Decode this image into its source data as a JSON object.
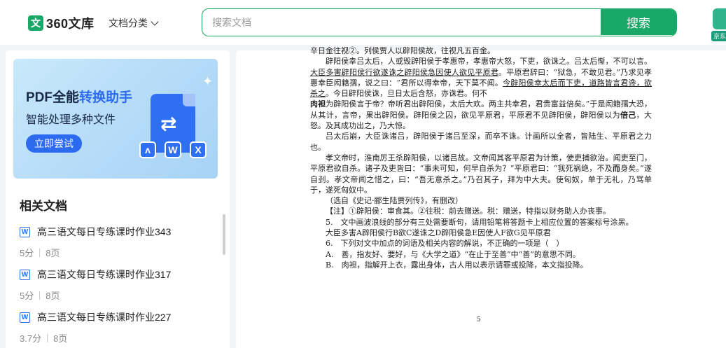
{
  "header": {
    "logo_mark": "文",
    "logo_text": "360文库",
    "category_label": "文档分类",
    "search_placeholder": "搜索文档",
    "search_button": "搜索",
    "promo_label": "京东"
  },
  "sidebar": {
    "banner": {
      "title_prefix": "PDF全能",
      "title_highlight": "转换助手",
      "subtitle": "智能处理多种文件",
      "cta": "立即尝试",
      "mini_icons": [
        "ᴧ",
        "W",
        "X"
      ]
    },
    "related_title": "相关文档",
    "related": [
      {
        "type_icon": "W",
        "name": "高三语文每日专练课时作业343",
        "score": "5分",
        "pages": "8页"
      },
      {
        "type_icon": "W",
        "name": "高三语文每日专练课时作业317",
        "score": "5分",
        "pages": "8页"
      },
      {
        "type_icon": "W",
        "name": "高三语文每日专练课时作业227",
        "score": "3.7分",
        "pages": "8页"
      }
    ]
  },
  "document": {
    "lines": {
      "l0": "辛日金往视②。列侯贾人以辟阳侯故，往视凡五百金。",
      "p1a": "辟阳侯幸吕太后，人或毁辟阳侯于孝惠帝，孝惠帝大怒，下吏，欲诛之。吕太后惭，不可以言。",
      "p1u": "大臣多害辟阳侯行欲遂诛之辟阳侯急因使人欲见平原君",
      "p1b": "。平原君辞曰：“狱急，不敢见君。”乃求见孝惠幸臣闳籍孺，说之曰：“君所以得幸帝，天下莫不闻。",
      "p1u2": "今辟阳侯幸太后而下吏，道路皆言君谗，欲杀之",
      "p1c": "。今日辟阳侯诛，旦日太后含怒，亦诛君。何不",
      "p1bold": "肉袒",
      "p1d": "为辟阳侯言于帝？帝听君出辟阳侯，太后大欢。两主共幸君，君贵富益倍矣。”于是闳籍孺大恐，从其计，言帝，果出辟阳侯。辟阳侯之囚，欲见平原君，平原君不见辟阳侯，辟阳侯以为",
      "p1bold2": "倍己",
      "p1e": "，大怒。及其成功出之，乃大惊。",
      "p2": "吕太后崩，大臣诛诸吕，辟阳侯于诸吕至深，而卒不诛。计画所以全者，皆陆生、平原君之力也。",
      "p3a": "孝文帝时，淮南厉王杀辟阳侯，以诸吕故。文帝闻其客平原君为计策，使吏捕欲治。闻吏至门，平原君欲自杀。诸子及吏皆曰：“事未可知，何早自杀为？”平原君曰：“我死祸绝，不及",
      "p3bold": "而",
      "p3b": "身矣。”遂自刭。孝文帝闻之惜之，曰：“吾无意杀之。”乃召其子，拜为中大夫。使匈奴，单于无礼，乃骂单于，遂死匈奴中。",
      "source": "（选自《史记·郦生陆贾列传》，有删改）",
      "note": "【注】①辟阳侯：审食其。②往税：前去赠送。税：赠送，特指以财务助人办丧事。",
      "q5": "5.　文中画波浪线的部分有三处需要断句，请用铅笔将答题卡上相应位置的答案标号涂黑。",
      "q5opt": "大臣多害A辟阳侯行B欲C遂诛之D辟阳侯急E因使人F欲G见平原君",
      "q6": "6.　下列对文中加点的词语及相关内容的解说，不正确的一项是（　）",
      "q6a": "A.　善，指友好、要好，与《大学之道》“在止于至善”中“善”的意思不同。",
      "q6b": "B.　肉袒，指解开上衣，露出身体，古人用以表示请罪或投降，本文指投降。"
    },
    "page_number": "5"
  }
}
